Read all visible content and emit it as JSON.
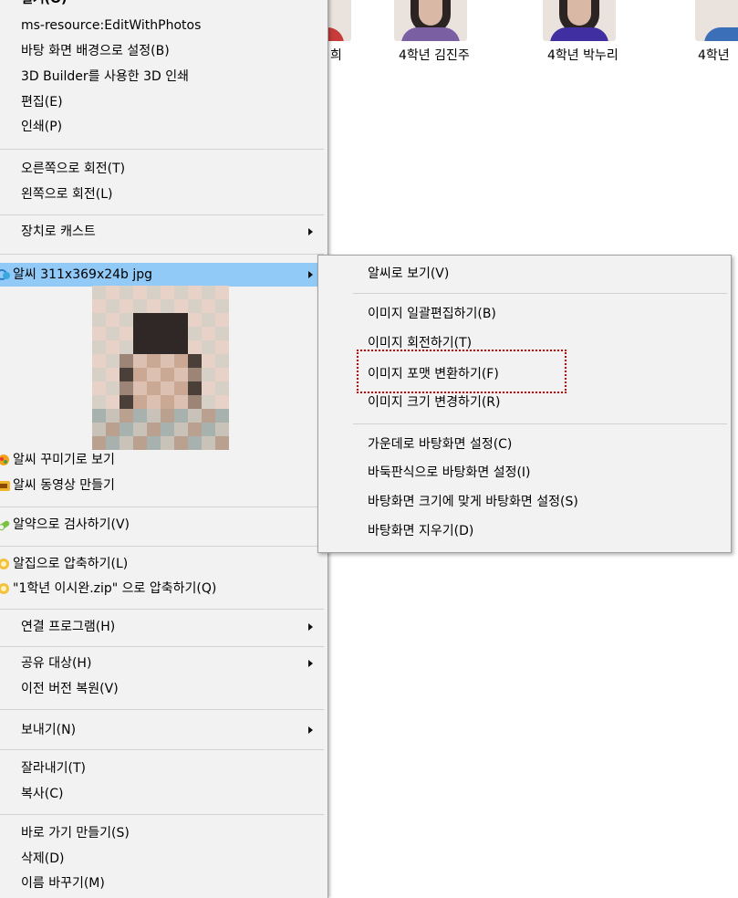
{
  "thumbnails": [
    {
      "label": "희",
      "shirt": "#c73b3b"
    },
    {
      "label": "4학년 김진주",
      "shirt": "#7b5fa3"
    },
    {
      "label": "4학년 박누리",
      "shirt": "#3f2fa0"
    },
    {
      "label": "4학년",
      "shirt": "#3b6fb8"
    }
  ],
  "main_menu": {
    "open": "열기(O)",
    "items_group1": [
      "ms-resource:EditWithPhotos",
      "바탕 화면 배경으로 설정(B)",
      "3D Builder를 사용한 3D 인쇄",
      "편집(E)",
      "인쇄(P)"
    ],
    "rotate_right": "오른쪽으로 회전(T)",
    "rotate_left": "왼쪽으로 회전(L)",
    "cast": "장치로 캐스트",
    "alsee": "알씨 311x369x24b jpg",
    "alsee_decorate": "알씨 꾸미기로 보기",
    "alsee_video": "알씨 동영상 만들기",
    "alyac": "알약으로 검사하기(V)",
    "alzip": "알집으로 압축하기(L)",
    "alzip_named": "\"1학년 이시완.zip\" 으로 압축하기(Q)",
    "open_with": "연결 프로그램(H)",
    "share_with": "공유 대상(H)",
    "restore": "이전 버전 복원(V)",
    "send_to": "보내기(N)",
    "cut": "잘라내기(T)",
    "copy": "복사(C)",
    "shortcut": "바로 가기 만들기(S)",
    "delete": "삭제(D)",
    "rename": "이름 바꾸기(M)"
  },
  "sub_menu": {
    "view": "알씨로 보기(V)",
    "batch_edit": "이미지 일괄편집하기(B)",
    "rotate": "이미지 회전하기(T)",
    "format": "이미지 포맷 변환하기(F)",
    "resize": "이미지 크기 변경하기(R)",
    "wall_center": "가운데로 바탕화면 설정(C)",
    "wall_tile": "바둑판식으로 바탕화면 설정(I)",
    "wall_fit": "바탕화면 크기에 맞게 바탕화면 설정(S)",
    "wall_clear": "바탕화면 지우기(D)"
  },
  "colors": {
    "highlight": "#91c9f7",
    "menu_bg": "#f2f2f2",
    "focus_box": "#cc0000"
  },
  "icons": [
    "alsee-icon",
    "alsee-decorate-icon",
    "alsee-video-icon",
    "alyac-icon",
    "alzip-icon",
    "chevron-right-icon"
  ]
}
